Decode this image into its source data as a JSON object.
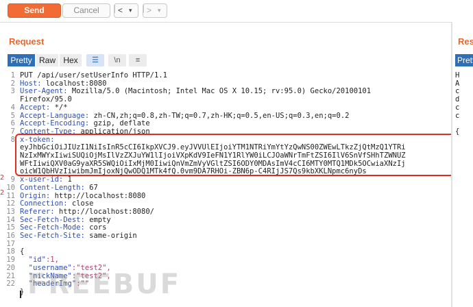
{
  "toolbar": {
    "send_label": "Send",
    "cancel_label": "Cancel",
    "prev_label": "<",
    "prev_drop": "▾",
    "next_label": ">",
    "next_drop": "▾"
  },
  "request": {
    "title": "Request",
    "tabs": [
      "Pretty",
      "Raw",
      "Hex"
    ],
    "icons": {
      "wrap": "☰",
      "newline": "\\n",
      "menu": "≡"
    }
  },
  "response": {
    "title": "Res",
    "tab": "Pretty",
    "lines": [
      "H",
      "A",
      "c",
      "d",
      "c",
      "c",
      "",
      "{"
    ]
  },
  "lines": [
    {
      "n": "1",
      "k": "PUT /api/user/setUserInfo HTTP/1.1",
      "v": ""
    },
    {
      "n": "2",
      "k": "Host:",
      "v": " localhost:8080"
    },
    {
      "n": "3",
      "k": "User-Agent:",
      "v": " Mozilla/5.0 (Macintosh; Intel Mac OS X 10.15; rv:95.0) Gecko/20100101"
    },
    {
      "n": "",
      "k": "",
      "v": "Firefox/95.0"
    },
    {
      "n": "4",
      "k": "Accept:",
      "v": " */*"
    },
    {
      "n": "5",
      "k": "Accept-Language:",
      "v": " zh-CN,zh;q=0.8,zh-TW;q=0.7,zh-HK;q=0.5,en-US;q=0.3,en;q=0.2"
    },
    {
      "n": "6",
      "k": "Accept-Encoding:",
      "v": " gzip, deflate"
    },
    {
      "n": "7",
      "k": "Content-Type:",
      "v": " application/json"
    },
    {
      "n": "8",
      "k": "x-token:",
      "v": ""
    },
    {
      "n": "",
      "k": "",
      "v": "eyJhbGciOiJIUzI1NiIsInR5cCI6IkpXVCJ9.eyJVVUlEIjoiYTM1NTRiYmYtYzQwNS00ZWEwLTkzZjQtMzQ1YTRi"
    },
    {
      "n": "",
      "k": "",
      "v": "NzIxMWYxIiwiSUQiOjMsIlVzZXJuYW1lIjoiVXpKdV9IeFN1Y1RlYW0iLCJOaWNrTmFtZSI6IlV6SnVfSHhTZWNUZ"
    },
    {
      "n": "",
      "k": "",
      "v": "WFtIiwiQXV0aG9yaXR5SWQiOiIxMjM0IiwiQnVmZmVyVGltZSI6ODY0MDAsImV4cCI6MTY0MTQ1MDk5OCwiaXNzIj"
    },
    {
      "n": "",
      "k": "",
      "v": "oicW1QbHVzIiwibmJmIjoxNjQwODQ1MTk4fQ.0vm9DA7RHOi-ZBN6p-C4RIjJS7Qs9kbXKLNpmc6nyDs"
    },
    {
      "n": "9",
      "k": "x-user-id:",
      "v": " 1"
    },
    {
      "n": "10",
      "k": "Content-Length:",
      "v": " 67"
    },
    {
      "n": "11",
      "k": "Origin:",
      "v": " http://localhost:8080"
    },
    {
      "n": "12",
      "k": "Connection:",
      "v": " close"
    },
    {
      "n": "13",
      "k": "Referer:",
      "v": " http://localhost:8080/"
    },
    {
      "n": "14",
      "k": "Sec-Fetch-Dest:",
      "v": " empty"
    },
    {
      "n": "15",
      "k": "Sec-Fetch-Mode:",
      "v": " cors"
    },
    {
      "n": "16",
      "k": "Sec-Fetch-Site:",
      "v": " same-origin"
    },
    {
      "n": "17",
      "k": "",
      "v": ""
    },
    {
      "n": "18",
      "k": "",
      "v": "{"
    },
    {
      "n": "19",
      "k": "  \"id\"",
      "v": ":1,"
    },
    {
      "n": "20",
      "k": "  \"username\"",
      "v": ":\"test2\","
    },
    {
      "n": "21",
      "k": "  \"nickName\"",
      "v": ":\"test2\","
    },
    {
      "n": "22",
      "k": "  \"headerImg\"",
      "v": ":\"\""
    },
    {
      "n": "",
      "k": "",
      "v": "}"
    }
  ],
  "markers": [
    "2",
    "2"
  ],
  "watermark": "FREEBUF",
  "colors": {
    "accent": "#f26b34",
    "tab_active": "#2f6fb5",
    "highlight": "#e02b1f"
  }
}
